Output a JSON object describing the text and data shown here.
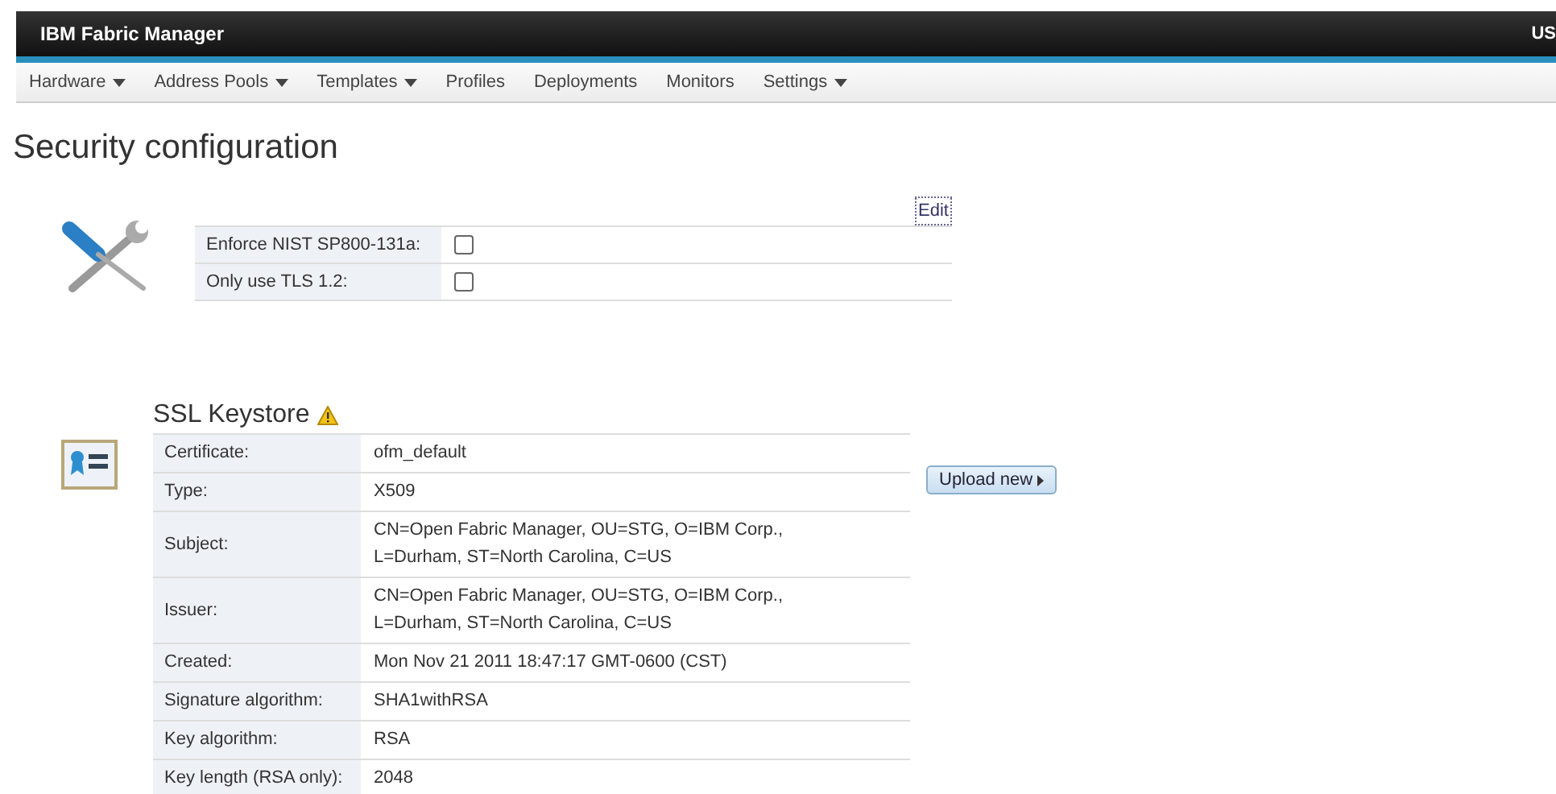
{
  "app_title": "IBM Fabric Manager",
  "user_label": "US",
  "nav": [
    {
      "label": "Hardware",
      "dropdown": true
    },
    {
      "label": "Address Pools",
      "dropdown": true
    },
    {
      "label": "Templates",
      "dropdown": true
    },
    {
      "label": "Profiles",
      "dropdown": false
    },
    {
      "label": "Deployments",
      "dropdown": false
    },
    {
      "label": "Monitors",
      "dropdown": false
    },
    {
      "label": "Settings",
      "dropdown": true
    }
  ],
  "page_title": "Security configuration",
  "security": {
    "edit_link": "Edit",
    "options": [
      {
        "label": "Enforce NIST SP800-131a:",
        "checked": false
      },
      {
        "label": "Only use TLS 1.2:",
        "checked": false
      }
    ]
  },
  "keystore": {
    "title": "SSL Keystore",
    "warning": true,
    "upload_button": "Upload new",
    "rows": [
      {
        "label": "Certificate:",
        "value": "ofm_default"
      },
      {
        "label": "Type:",
        "value": "X509"
      },
      {
        "label": "Subject:",
        "value": "CN=Open Fabric Manager, OU=STG, O=IBM Corp., L=Durham, ST=North Carolina, C=US"
      },
      {
        "label": "Issuer:",
        "value": "CN=Open Fabric Manager, OU=STG, O=IBM Corp., L=Durham, ST=North Carolina, C=US"
      },
      {
        "label": "Created:",
        "value": "Mon Nov 21 2011 18:47:17 GMT-0600 (CST)"
      },
      {
        "label": "Signature algorithm:",
        "value": "SHA1withRSA"
      },
      {
        "label": "Key algorithm:",
        "value": "RSA"
      },
      {
        "label": "Key length (RSA only):",
        "value": "2048"
      }
    ]
  }
}
